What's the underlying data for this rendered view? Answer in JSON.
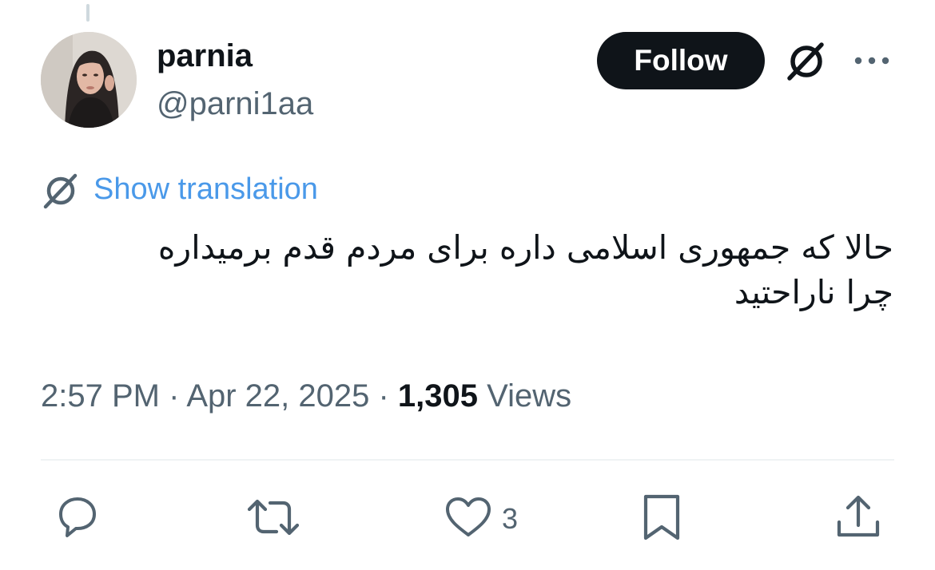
{
  "user": {
    "display_name": "parnia",
    "handle": "@parni1aa",
    "avatar": "avatar"
  },
  "header": {
    "follow_label": "Follow",
    "grok_icon": "grok-icon",
    "more_icon": "more-icon"
  },
  "translation": {
    "icon": "grok-icon",
    "label": "Show translation"
  },
  "tweet": {
    "lines": [
      "حالا که جمهوری اسلامی داره برای مردم قدم برمیداره",
      "چرا ناراحتید"
    ]
  },
  "meta": {
    "time": "2:57 PM",
    "separator1": " · ",
    "date": "Apr 22, 2025",
    "separator2": " · ",
    "views_count": "1,305",
    "views_label": " Views"
  },
  "actions": {
    "reply_icon": "reply-icon",
    "retweet_icon": "retweet-icon",
    "like_icon": "heart-icon",
    "like_count": "3",
    "bookmark_icon": "bookmark-icon",
    "share_icon": "share-icon"
  },
  "colors": {
    "text_primary": "#0f1419",
    "text_secondary": "#536471",
    "link": "#4a99e9",
    "button_bg": "#0f1419",
    "divider": "#eff3f4"
  }
}
